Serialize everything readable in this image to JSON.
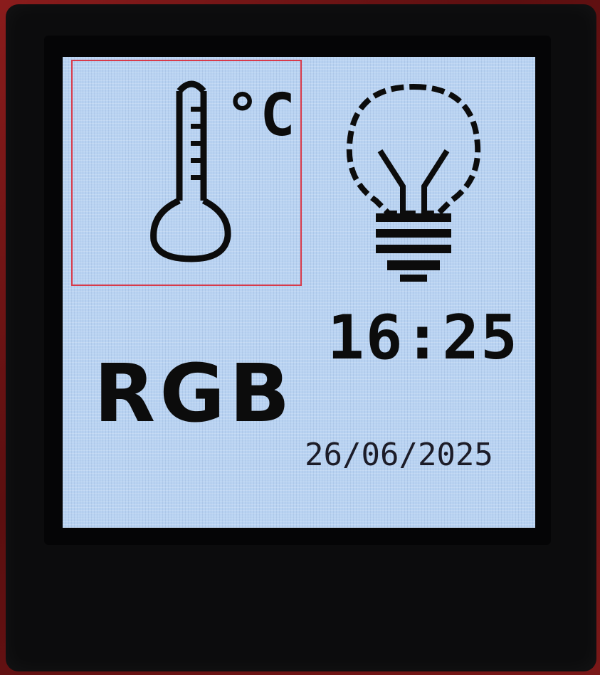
{
  "device": {
    "tiles": {
      "temperature": {
        "icon": "thermometer-icon",
        "unit_label": "°C",
        "selected": true
      },
      "light": {
        "icon": "light-bulb-icon"
      },
      "rgb": {
        "label": "RGB"
      }
    },
    "clock": {
      "time": "16:25",
      "date": "26/06/2025"
    }
  },
  "colors": {
    "screen_bg": "#b9d3f2",
    "selection_border": "#d83a4a",
    "text": "#0c0c0c"
  }
}
